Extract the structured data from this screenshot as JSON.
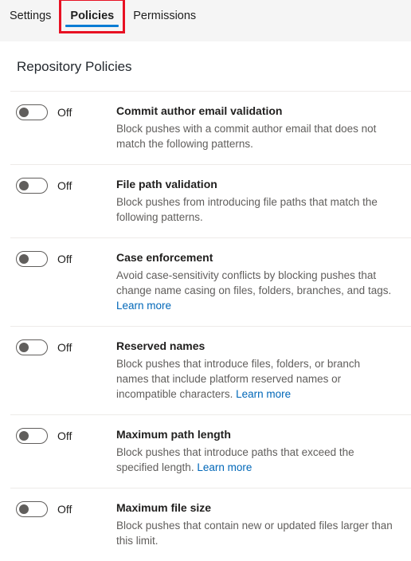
{
  "tabs": [
    {
      "label": "Settings",
      "active": false,
      "highlighted": false
    },
    {
      "label": "Policies",
      "active": true,
      "highlighted": true
    },
    {
      "label": "Permissions",
      "active": false,
      "highlighted": false
    }
  ],
  "section": {
    "heading": "Repository Policies"
  },
  "policies": [
    {
      "state_label": "Off",
      "enabled": false,
      "title": "Commit author email validation",
      "description": "Block pushes with a commit author email that does not match the following patterns.",
      "link_text": ""
    },
    {
      "state_label": "Off",
      "enabled": false,
      "title": "File path validation",
      "description": "Block pushes from introducing file paths that match the following patterns.",
      "link_text": ""
    },
    {
      "state_label": "Off",
      "enabled": false,
      "title": "Case enforcement",
      "description": "Avoid case-sensitivity conflicts by blocking pushes that change name casing on files, folders, branches, and tags.",
      "link_text": "Learn more"
    },
    {
      "state_label": "Off",
      "enabled": false,
      "title": "Reserved names",
      "description": "Block pushes that introduce files, folders, or branch names that include platform reserved names or incompatible characters.",
      "link_text": "Learn more"
    },
    {
      "state_label": "Off",
      "enabled": false,
      "title": "Maximum path length",
      "description": "Block pushes that introduce paths that exceed the specified length.",
      "link_text": "Learn more"
    },
    {
      "state_label": "Off",
      "enabled": false,
      "title": "Maximum file size",
      "description": "Block pushes that contain new or updated files larger than this limit.",
      "link_text": ""
    }
  ],
  "colors": {
    "accent_blue": "#0a7cd4",
    "link_blue": "#0067b8",
    "highlight_red": "#e81123",
    "tabbar_bg": "#f5f5f5",
    "divider": "#edebe9",
    "text_primary": "#201f1e",
    "text_secondary": "#605e5c"
  }
}
